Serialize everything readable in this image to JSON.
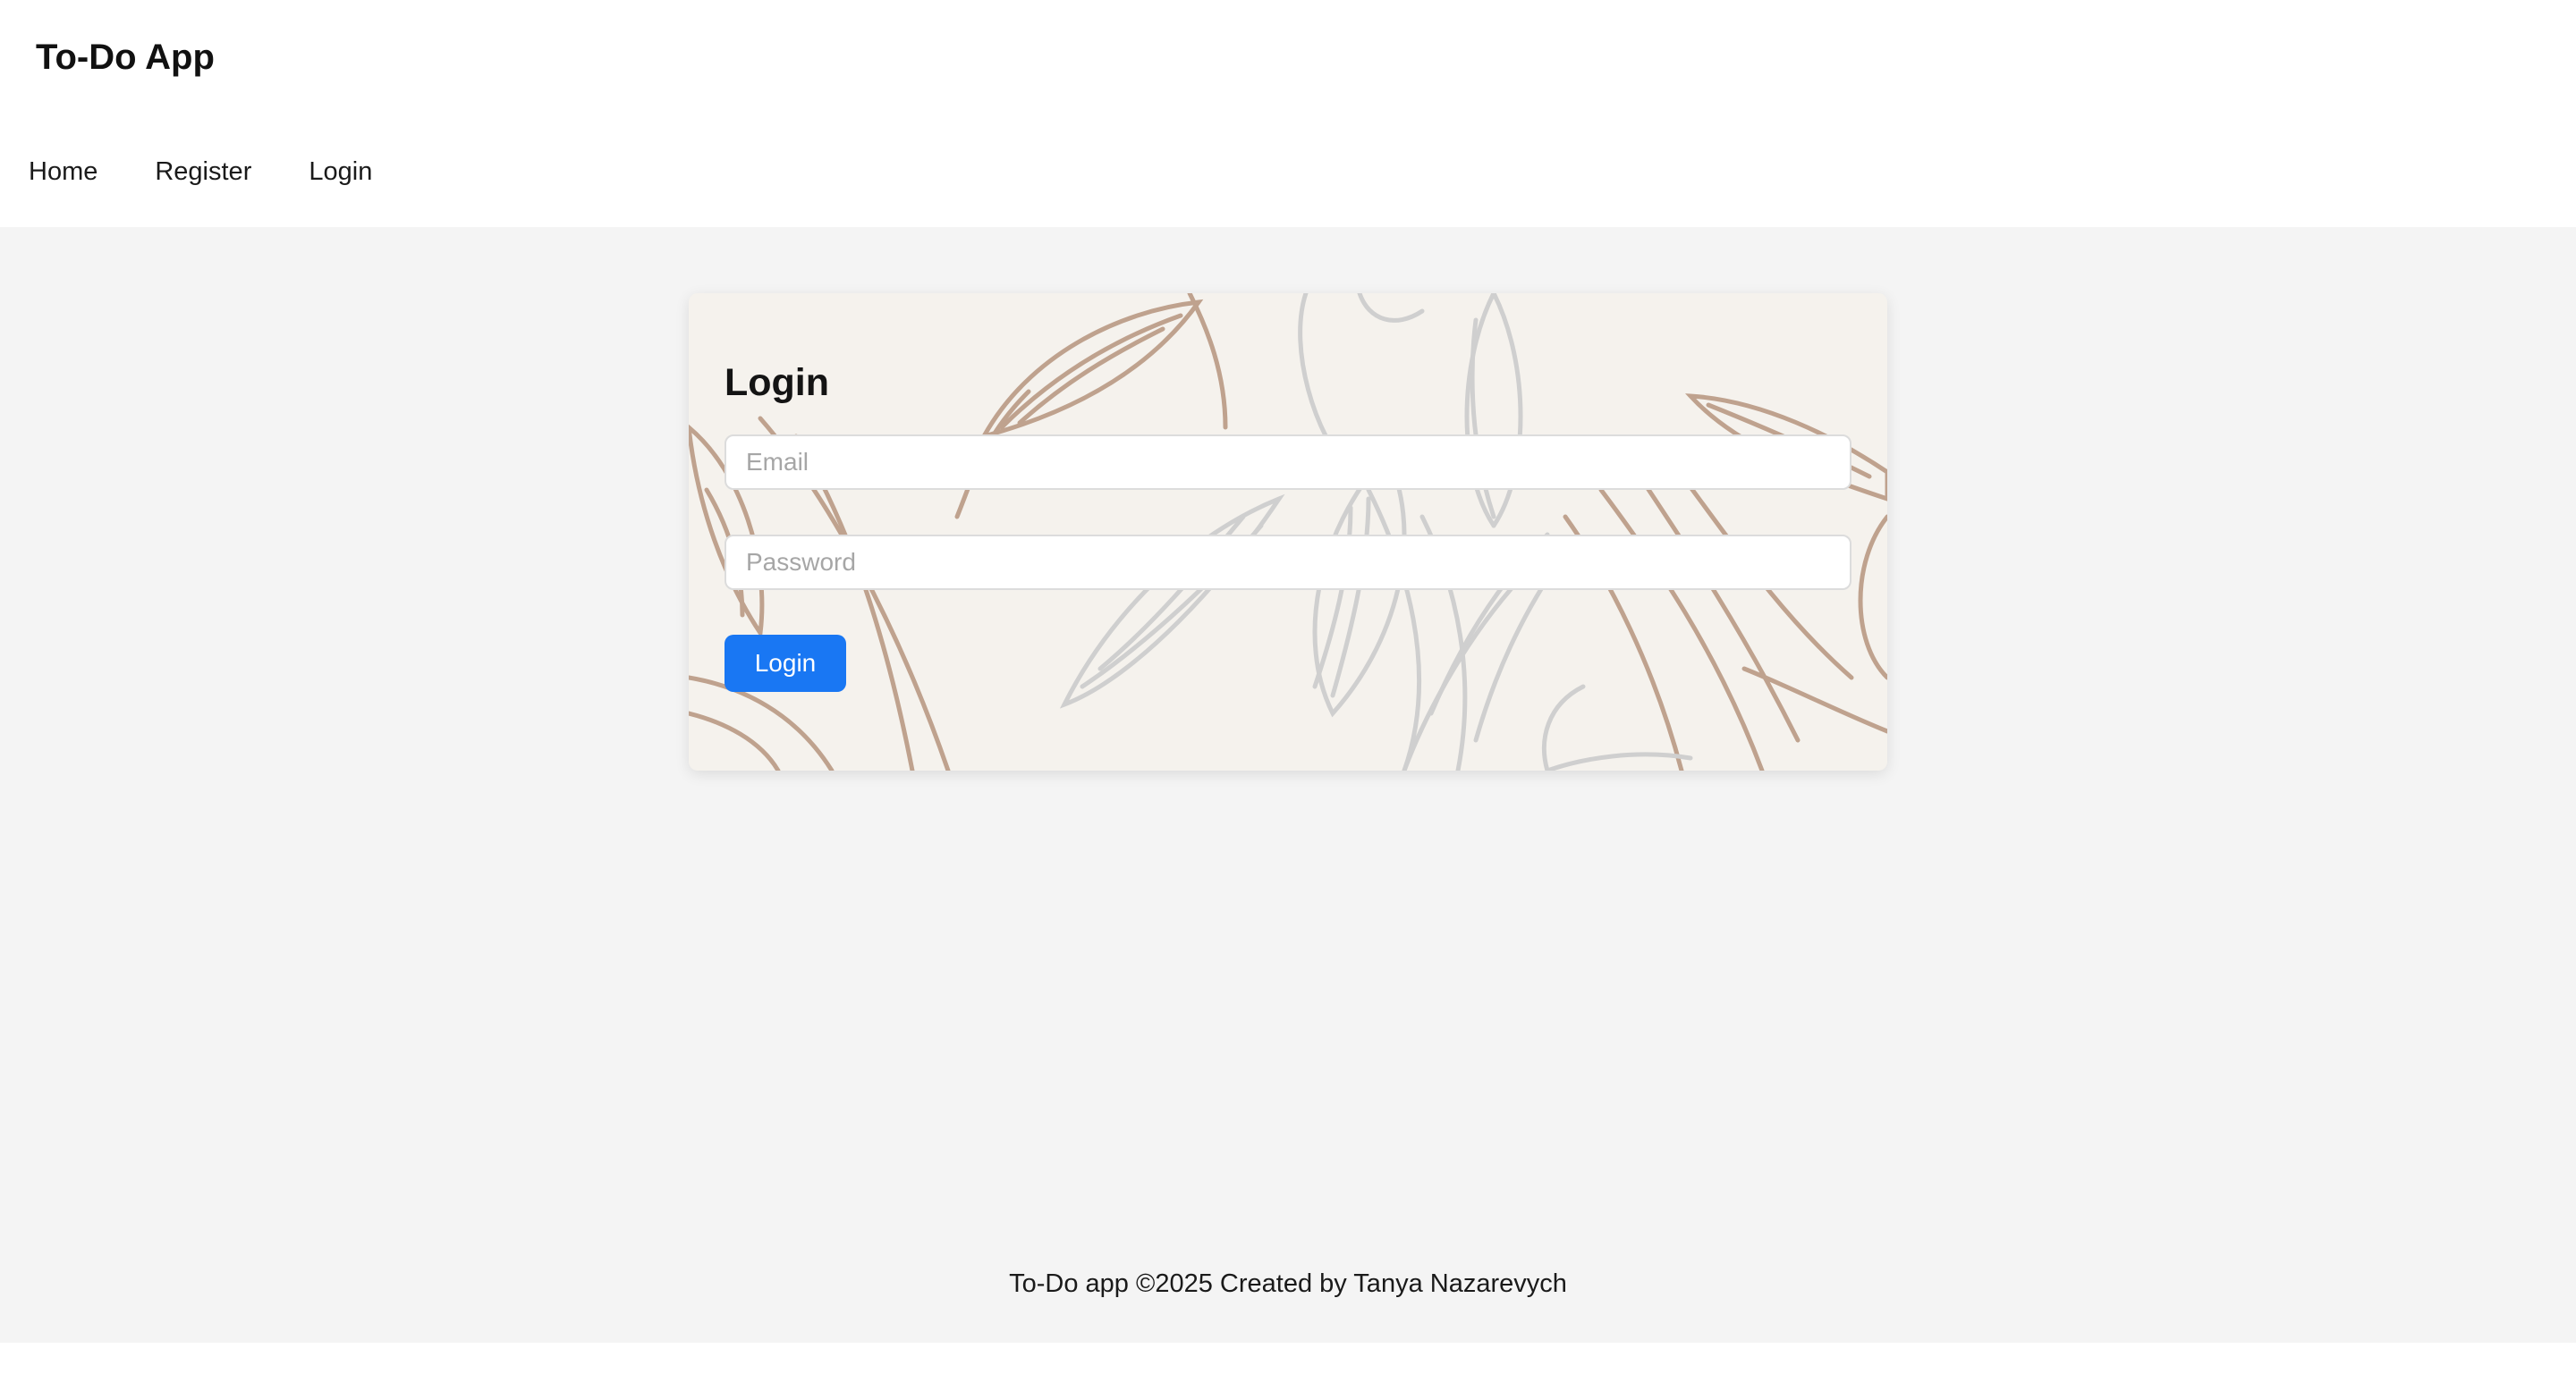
{
  "header": {
    "brand": "To-Do App",
    "nav": [
      {
        "label": "Home"
      },
      {
        "label": "Register"
      },
      {
        "label": "Login"
      }
    ]
  },
  "login_card": {
    "title": "Login",
    "email": {
      "placeholder": "Email",
      "value": ""
    },
    "password": {
      "placeholder": "Password",
      "value": ""
    },
    "submit_label": "Login"
  },
  "footer": {
    "text": "To-Do app ©2025 Created by Tanya Nazarevych"
  },
  "colors": {
    "primary_button": "#1977f3",
    "page_background": "#f4f4f4",
    "card_background": "#f5f2ed",
    "leaf_brown": "#bfa28e",
    "leaf_gray": "#cfcfcf"
  }
}
